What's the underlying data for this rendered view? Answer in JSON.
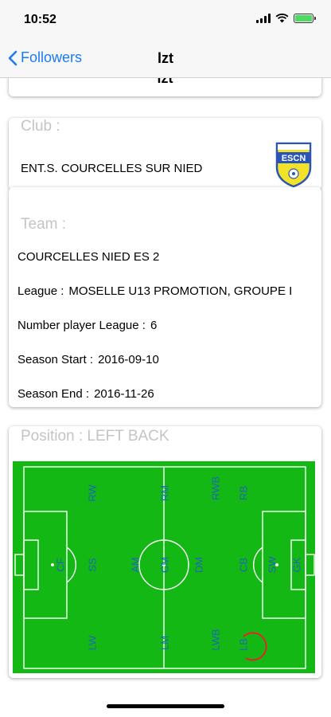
{
  "status": {
    "time": "10:52"
  },
  "nav": {
    "back_label": "Followers",
    "title": "lzt"
  },
  "previous_card": {
    "text": "lzt"
  },
  "club": {
    "label": "Club :",
    "name": "ENT.S. COURCELLES SUR NIED",
    "badge_text": "ESCN"
  },
  "team": {
    "label": "Team :",
    "name": "COURCELLES NIED ES 2",
    "league_label": "League :",
    "league_value": "MOSELLE U13 PROMOTION, GROUPE I",
    "players_label": "Number player League :",
    "players_value": "6",
    "season_start_label": "Season Start :",
    "season_start_value": "2016-09-10",
    "season_end_label": "Season End :",
    "season_end_value": "2016-11-26"
  },
  "position": {
    "label": "Position : LEFT BACK",
    "selected": "LB",
    "labels": [
      "RW",
      "RM",
      "RWB",
      "RB",
      "CF",
      "SS",
      "AM",
      "CM",
      "DM",
      "CB",
      "SW",
      "GK",
      "LW",
      "LM",
      "LWB",
      "LB"
    ]
  },
  "colors": {
    "accent": "#1a7cf5",
    "pitch": "#14b814",
    "position_text": "#1f66b8",
    "highlight": "#e0262a"
  },
  "icons": {
    "back": "chevron-left-icon",
    "signal": "signal-icon",
    "wifi": "wifi-icon",
    "battery": "battery-icon"
  }
}
